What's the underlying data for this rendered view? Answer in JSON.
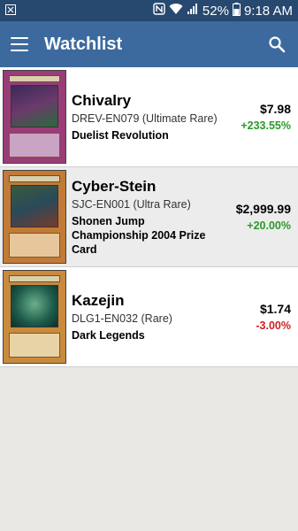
{
  "status_bar": {
    "time": "9:18 AM",
    "battery": "52%",
    "icons": [
      "notification-icon",
      "nfc-icon",
      "wifi-icon",
      "signal-icon",
      "battery-icon"
    ]
  },
  "app_bar": {
    "title": "Watchlist",
    "menu_icon": "hamburger-menu-icon",
    "search_icon": "search-icon",
    "color": "#3c6a9e"
  },
  "watchlist": [
    {
      "name": "Chivalry",
      "code": "DREV-EN079 (Ultimate Rare)",
      "set": "Duelist Revolution",
      "price": "$7.98",
      "change": "+233.55%",
      "trend": "up",
      "card_color": "#b04a8a"
    },
    {
      "name": "Cyber-Stein",
      "code": "SJC-EN001 (Ultra Rare)",
      "set": "Shonen Jump Championship 2004 Prize Card",
      "price": "$2,999.99",
      "change": "+20.00%",
      "trend": "up",
      "card_color": "#c8782e"
    },
    {
      "name": "Kazejin",
      "code": "DLG1-EN032 (Rare)",
      "set": "Dark Legends",
      "price": "$1.74",
      "change": "-3.00%",
      "trend": "down",
      "card_color": "#2d6b6b"
    }
  ],
  "colors": {
    "positive": "#2a9a2a",
    "negative": "#cc2222",
    "status_bar": "#27486f"
  }
}
